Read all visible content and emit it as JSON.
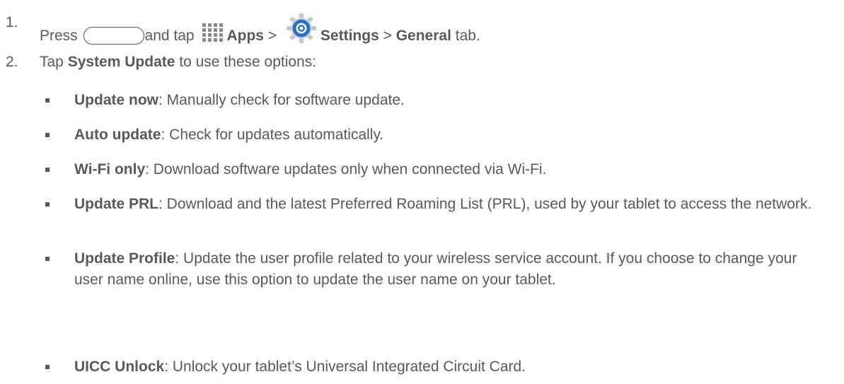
{
  "step1": {
    "number": "1.",
    "press": "Press",
    "and_tap": "and tap",
    "apps": "Apps",
    "sep1": ">",
    "settings": "Settings",
    "sep2": ">",
    "general": "General",
    "tab": "tab."
  },
  "step2": {
    "number": "2.",
    "tap": "Tap",
    "system_update": "System Update",
    "rest": "to use these options:"
  },
  "options": [
    {
      "label": "Update now",
      "text": ": Manually check for software update."
    },
    {
      "label": "Auto update",
      "text": ": Check for updates automatically."
    },
    {
      "label": "Wi-Fi only",
      "text": ": Download software updates only when connected via Wi-Fi."
    },
    {
      "label": "Update PRL",
      "text": ": Download and the latest Preferred Roaming List (PRL), used by your tablet to access the network."
    },
    {
      "label": "Update Profile",
      "text": ": Update the user profile related to your wireless service account. If you choose to change your user name online, use this option to update the user name on your tablet."
    },
    {
      "label": "UICC Unlock",
      "text": ": Unlock your tablet’s Universal Integrated Circuit Card."
    }
  ],
  "icons": {
    "home_button": "home-button-icon",
    "apps": "apps-grid-icon",
    "settings": "settings-gear-icon"
  },
  "colors": {
    "text": "#595959",
    "settings_blue": "#2a6fc9"
  }
}
